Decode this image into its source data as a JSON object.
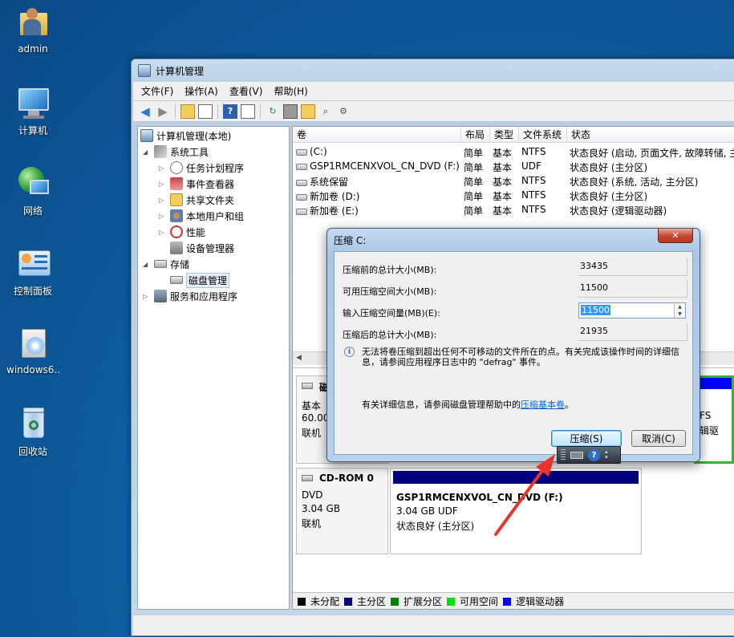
{
  "desktop": {
    "icons": [
      {
        "label": "admin",
        "icon": "user-folder-icon"
      },
      {
        "label": "计算机",
        "icon": "computer-icon"
      },
      {
        "label": "网络",
        "icon": "network-icon"
      },
      {
        "label": "控制面板",
        "icon": "control-panel-icon"
      },
      {
        "label": "windows6....",
        "icon": "installer-icon"
      },
      {
        "label": "回收站",
        "icon": "recycle-bin-icon"
      }
    ]
  },
  "window": {
    "title": "计算机管理",
    "menu": [
      "文件(F)",
      "操作(A)",
      "查看(V)",
      "帮助(H)"
    ],
    "tree": {
      "root": "计算机管理(本地)",
      "system_tools": "系统工具",
      "task_scheduler": "任务计划程序",
      "event_viewer": "事件查看器",
      "shared_folders": "共享文件夹",
      "local_users": "本地用户和组",
      "performance": "性能",
      "device_manager": "设备管理器",
      "storage": "存储",
      "disk_management": "磁盘管理",
      "services": "服务和应用程序"
    },
    "volumes": {
      "headers": [
        "卷",
        "布局",
        "类型",
        "文件系统",
        "状态"
      ],
      "rows": [
        {
          "name": "(C:)",
          "layout": "简单",
          "type": "基本",
          "fs": "NTFS",
          "status": "状态良好 (启动, 页面文件, 故障转储, 主"
        },
        {
          "name": "GSP1RMCENXVOL_CN_DVD (F:)",
          "layout": "简单",
          "type": "基本",
          "fs": "UDF",
          "status": "状态良好 (主分区)"
        },
        {
          "name": "系统保留",
          "layout": "简单",
          "type": "基本",
          "fs": "NTFS",
          "status": "状态良好 (系统, 活动, 主分区)"
        },
        {
          "name": "新加卷 (D:)",
          "layout": "简单",
          "type": "基本",
          "fs": "NTFS",
          "status": "状态良好 (主分区)"
        },
        {
          "name": "新加卷 (E:)",
          "layout": "简单",
          "type": "基本",
          "fs": "NTFS",
          "status": "状态良好 (逻辑驱动器)"
        }
      ]
    },
    "disk0": {
      "name": "磁",
      "type": "基本",
      "size": "60.00",
      "state": "联机",
      "right_fs": "FS",
      "right_text": "辑驱"
    },
    "cdrom": {
      "name": "CD-ROM 0",
      "type": "DVD",
      "size": "3.04 GB",
      "state": "联机",
      "vol_name": "GSP1RMCENXVOL_CN_DVD (F:)",
      "vol_size": "3.04 GB UDF",
      "vol_status": "状态良好 (主分区)"
    },
    "legend": [
      "未分配",
      "主分区",
      "扩展分区",
      "可用空间",
      "逻辑驱动器"
    ],
    "legend_colors": [
      "#000000",
      "#000080",
      "#008000",
      "#00e000",
      "#0000ff"
    ]
  },
  "dialog": {
    "title": "压缩 C:",
    "close_glyph": "✕",
    "label_total_before": "压缩前的总计大小(MB):",
    "value_total_before": "33435",
    "label_available": "可用压缩空间大小(MB):",
    "value_available": "11500",
    "label_input": "输入压缩空间量(MB)(E):",
    "value_input": "11500",
    "label_total_after": "压缩后的总计大小(MB):",
    "value_total_after": "21935",
    "info_text": "无法将卷压缩到超出任何不可移动的文件所在的点。有关完成该操作时间的详细信息，请参阅应用程序日志中的 \"defrag\" 事件。",
    "help_prefix": "有关详细信息，请参阅磁盘管理帮助中的",
    "help_link": "压缩基本卷",
    "help_suffix": "。",
    "shrink_button": "压缩(S)",
    "cancel_button": "取消(C)"
  },
  "colors": {
    "accent": "#3399ff",
    "arrow": "#e8352b",
    "link": "#0066cc"
  }
}
